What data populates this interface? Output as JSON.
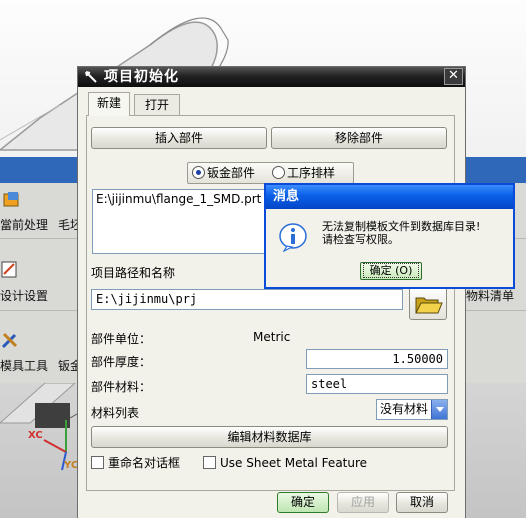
{
  "background": {
    "toolbar_labels": [
      "當前处理",
      "毛坯",
      "设计设置",
      "模具工具",
      "钣金",
      "物料清单"
    ],
    "axis_labels": [
      "XC",
      "YC"
    ]
  },
  "dialog": {
    "title": "项目初始化",
    "close_glyph": "✕",
    "tabs": [
      {
        "label": "新建"
      },
      {
        "label": "打开"
      }
    ],
    "insert_part_label": "插入部件",
    "remove_part_label": "移除部件",
    "radio_sheet_metal": "钣金部件",
    "radio_process": "工序排样",
    "parts_list": [
      "E:\\jijinmu\\flange_1_SMD.prt"
    ],
    "path_label": "项目路径和名称",
    "path_value": "E:\\jijinmu\\prj",
    "unit_label": "部件单位：",
    "unit_value": "Metric",
    "thickness_label": "部件厚度：",
    "thickness_value": "1.50000",
    "material_label": "部件材料：",
    "material_value": "steel",
    "material_list_label": "材料列表",
    "material_list_value": "没有材料",
    "edit_db_label": "编辑材料数据库",
    "rename_dialog_label": "重命名对话框",
    "use_sheet_metal_label": "Use Sheet Metal Feature",
    "ok_label": "确定",
    "apply_label": "应用",
    "cancel_label": "取消"
  },
  "message_box": {
    "title": "消息",
    "line1": "无法复制模板文件到数据库目录!",
    "line2": "请检查写权限。",
    "ok_label": "确定 (O)"
  },
  "colors": {
    "dialog_title_bar": "#1a1a1a",
    "message_title_bar": "#0a5fe6",
    "info_icon": "#2a6fd8",
    "ok_green": "#bfe6b2"
  }
}
